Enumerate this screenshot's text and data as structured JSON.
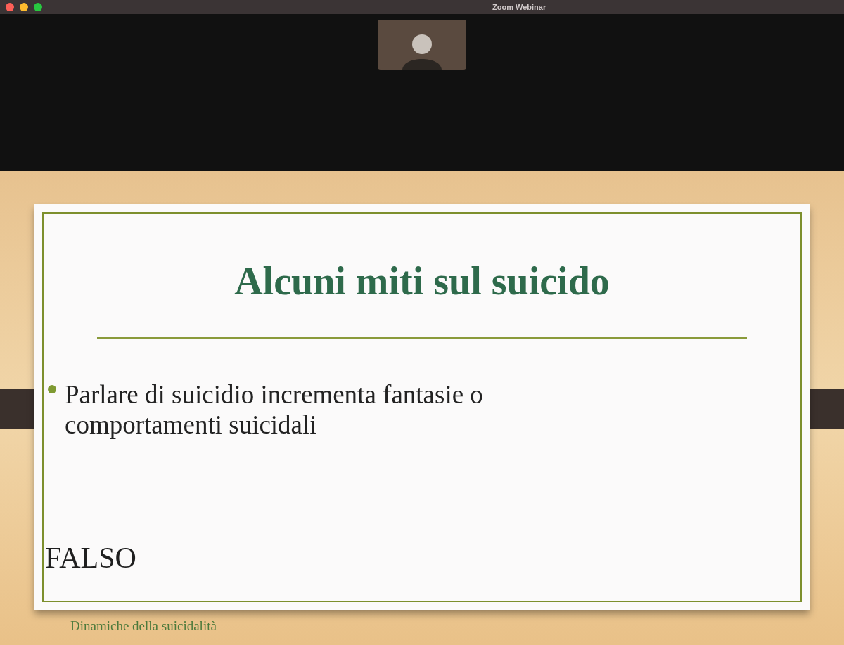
{
  "window": {
    "title": "Zoom Webinar"
  },
  "slide": {
    "title": "Alcuni miti sul suicido",
    "bullets": [
      "Parlare di suicidio incrementa fantasie o comportamenti suicidali"
    ],
    "answer": "FALSO",
    "footer": "Dinamiche della suicidalità"
  }
}
